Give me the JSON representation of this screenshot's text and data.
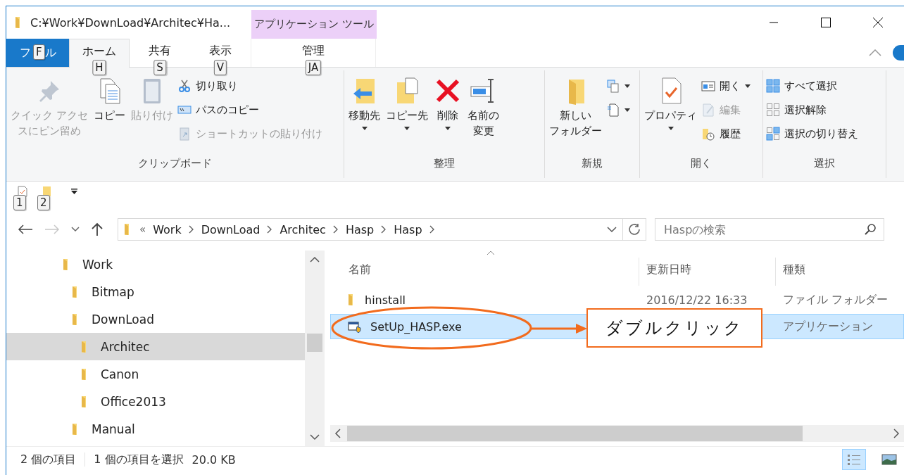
{
  "window": {
    "title": "C:¥Work¥DownLoad¥Architec¥Ha...",
    "context_tab": "アプリケーション ツール"
  },
  "file_tab": {
    "start": "フ",
    "keytip": "F",
    "end": "ル"
  },
  "tabs": [
    {
      "label": "ホーム",
      "keytip": "H",
      "selected": true,
      "kind": "normal"
    },
    {
      "label": "共有",
      "keytip": "S",
      "selected": false,
      "kind": "normal"
    },
    {
      "label": "表示",
      "keytip": "V",
      "selected": false,
      "kind": "normal"
    },
    {
      "label": "管理",
      "keytip": "JA",
      "selected": false,
      "kind": "context"
    }
  ],
  "ribbon": [
    {
      "label": "クリップボード",
      "items": [
        {
          "kind": "large",
          "label": "クイック アクセスにピン留め",
          "disabled": true,
          "has_menu": false
        },
        {
          "kind": "large",
          "label": "コピー",
          "disabled": false,
          "has_menu": false
        },
        {
          "kind": "large",
          "label": "貼り付け",
          "disabled": true,
          "has_menu": false
        },
        {
          "kind": "stack",
          "items": [
            {
              "label": "切り取り",
              "disabled": false,
              "has_menu": false
            },
            {
              "label": "パスのコピー",
              "disabled": false,
              "has_menu": false
            },
            {
              "label": "ショートカットの貼り付け",
              "disabled": true,
              "has_menu": false
            }
          ]
        }
      ]
    },
    {
      "label": "整理",
      "items": [
        {
          "kind": "large",
          "label": "移動先",
          "disabled": false,
          "has_menu": true
        },
        {
          "kind": "large",
          "label": "コピー先",
          "disabled": false,
          "has_menu": true
        },
        {
          "kind": "large",
          "label": "削除",
          "disabled": false,
          "has_menu": true
        },
        {
          "kind": "large",
          "label": "名前の変更",
          "disabled": false,
          "has_menu": false
        }
      ]
    },
    {
      "label": "新規",
      "items": [
        {
          "kind": "large",
          "label": "新しいフォルダー",
          "disabled": false,
          "has_menu": false
        },
        {
          "kind": "stack",
          "items": [
            {
              "disabled": false,
              "has_menu": true
            },
            {
              "disabled": false,
              "has_menu": true
            }
          ]
        }
      ]
    },
    {
      "label": "開く",
      "items": [
        {
          "kind": "large",
          "label": "プロパティ",
          "disabled": false,
          "has_menu": true
        },
        {
          "kind": "stack",
          "items": [
            {
              "label": "開く",
              "disabled": false,
              "has_menu": true
            },
            {
              "label": "編集",
              "disabled": true,
              "has_menu": false
            },
            {
              "label": "履歴",
              "disabled": false,
              "has_menu": false
            }
          ]
        }
      ]
    },
    {
      "label": "選択",
      "items": [
        {
          "kind": "stack",
          "items": [
            {
              "label": "すべて選択",
              "disabled": false,
              "has_menu": false
            },
            {
              "label": "選択解除",
              "disabled": false,
              "has_menu": false
            },
            {
              "label": "選択の切り替え",
              "disabled": false,
              "has_menu": false
            }
          ]
        }
      ]
    }
  ],
  "quick_access": {
    "keytips": [
      "1",
      "2"
    ]
  },
  "address": {
    "overflow": "«",
    "crumbs": [
      "Work",
      "DownLoad",
      "Architec",
      "Hasp",
      "Hasp"
    ],
    "forward_disabled": true
  },
  "search": {
    "placeholder": "Haspの検索"
  },
  "tree": [
    {
      "label": "Work",
      "selected": false,
      "children": [
        {
          "label": "Bitmap",
          "selected": false
        },
        {
          "label": "DownLoad",
          "selected": false,
          "children": [
            {
              "label": "Architec",
              "selected": true
            },
            {
              "label": "Canon",
              "selected": false
            },
            {
              "label": "Office2013",
              "selected": false
            }
          ]
        },
        {
          "label": "Manual",
          "selected": false
        }
      ]
    }
  ],
  "files": {
    "columns": [
      "名前",
      "更新日時",
      "種類"
    ],
    "rows": [
      {
        "name": "hinstall",
        "kind": "folder",
        "date": "2016/12/22 16:33",
        "type": "ファイル フォルダー",
        "selected": false
      },
      {
        "name": "SetUp_HASP.exe",
        "kind": "application",
        "type": "アプリケーション",
        "selected": true
      }
    ]
  },
  "callout": {
    "text": "ダブルクリック"
  },
  "status_bar": {
    "items": [
      "2 個の項目",
      "1 個の項目を選択",
      "20.0 KB"
    ],
    "views": [
      {
        "selected": true
      },
      {
        "selected": false
      }
    ]
  }
}
